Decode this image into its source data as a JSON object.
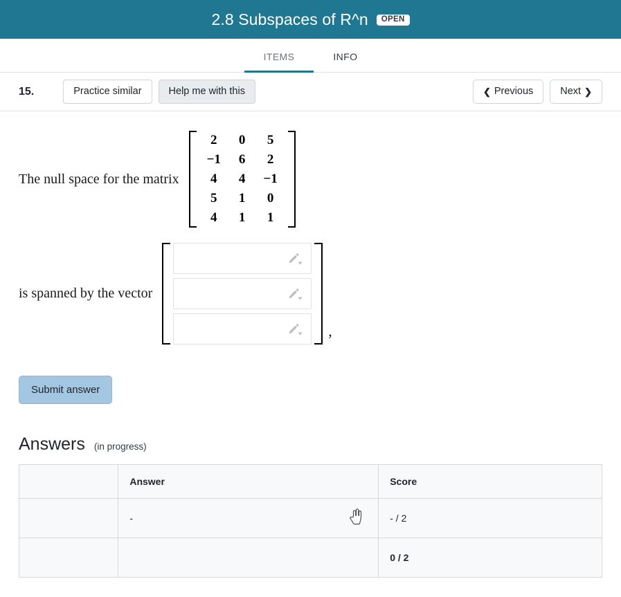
{
  "header": {
    "title": "2.8 Subspaces of R^n",
    "badge": "OPEN",
    "bg_color": "#1f7791"
  },
  "tabs": [
    {
      "label": "ITEMS",
      "active": true
    },
    {
      "label": "INFO",
      "active": false
    }
  ],
  "toolbar": {
    "item_number": "15.",
    "practice_label": "Practice similar",
    "help_label": "Help me with this",
    "previous_label": "Previous",
    "next_label": "Next",
    "prev_chevron": "‹-icon",
    "next_chevron": "›-icon"
  },
  "problem": {
    "lead_text": "The null space for the matrix",
    "matrix": {
      "rows": [
        [
          "2",
          "0",
          "5"
        ],
        [
          "−1",
          "6",
          "2"
        ],
        [
          "4",
          "4",
          "−1"
        ],
        [
          "5",
          "1",
          "0"
        ],
        [
          "4",
          "1",
          "1"
        ]
      ]
    },
    "spanned_text": "is spanned by the vector",
    "vector_inputs": [
      {
        "value": "",
        "placeholder": "",
        "icon": "pencil-dropdown-icon"
      },
      {
        "value": "",
        "placeholder": "",
        "icon": "pencil-dropdown-icon"
      },
      {
        "value": "",
        "placeholder": "",
        "icon": "pencil-dropdown-icon"
      }
    ],
    "trailing_comma": ",",
    "submit_label": "Submit answer",
    "submit_bg": "#a3c6e3"
  },
  "answers": {
    "title": "Answers",
    "subtitle": "(in progress)",
    "columns": [
      "",
      "Answer",
      "Score"
    ],
    "rows": [
      {
        "blank": "",
        "answer": "-",
        "score": "- / 2",
        "bold_score": false
      },
      {
        "blank": "",
        "answer": "",
        "score": "0 / 2",
        "bold_score": true
      }
    ]
  },
  "cursor": {
    "type": "pointing-hand-cursor"
  }
}
